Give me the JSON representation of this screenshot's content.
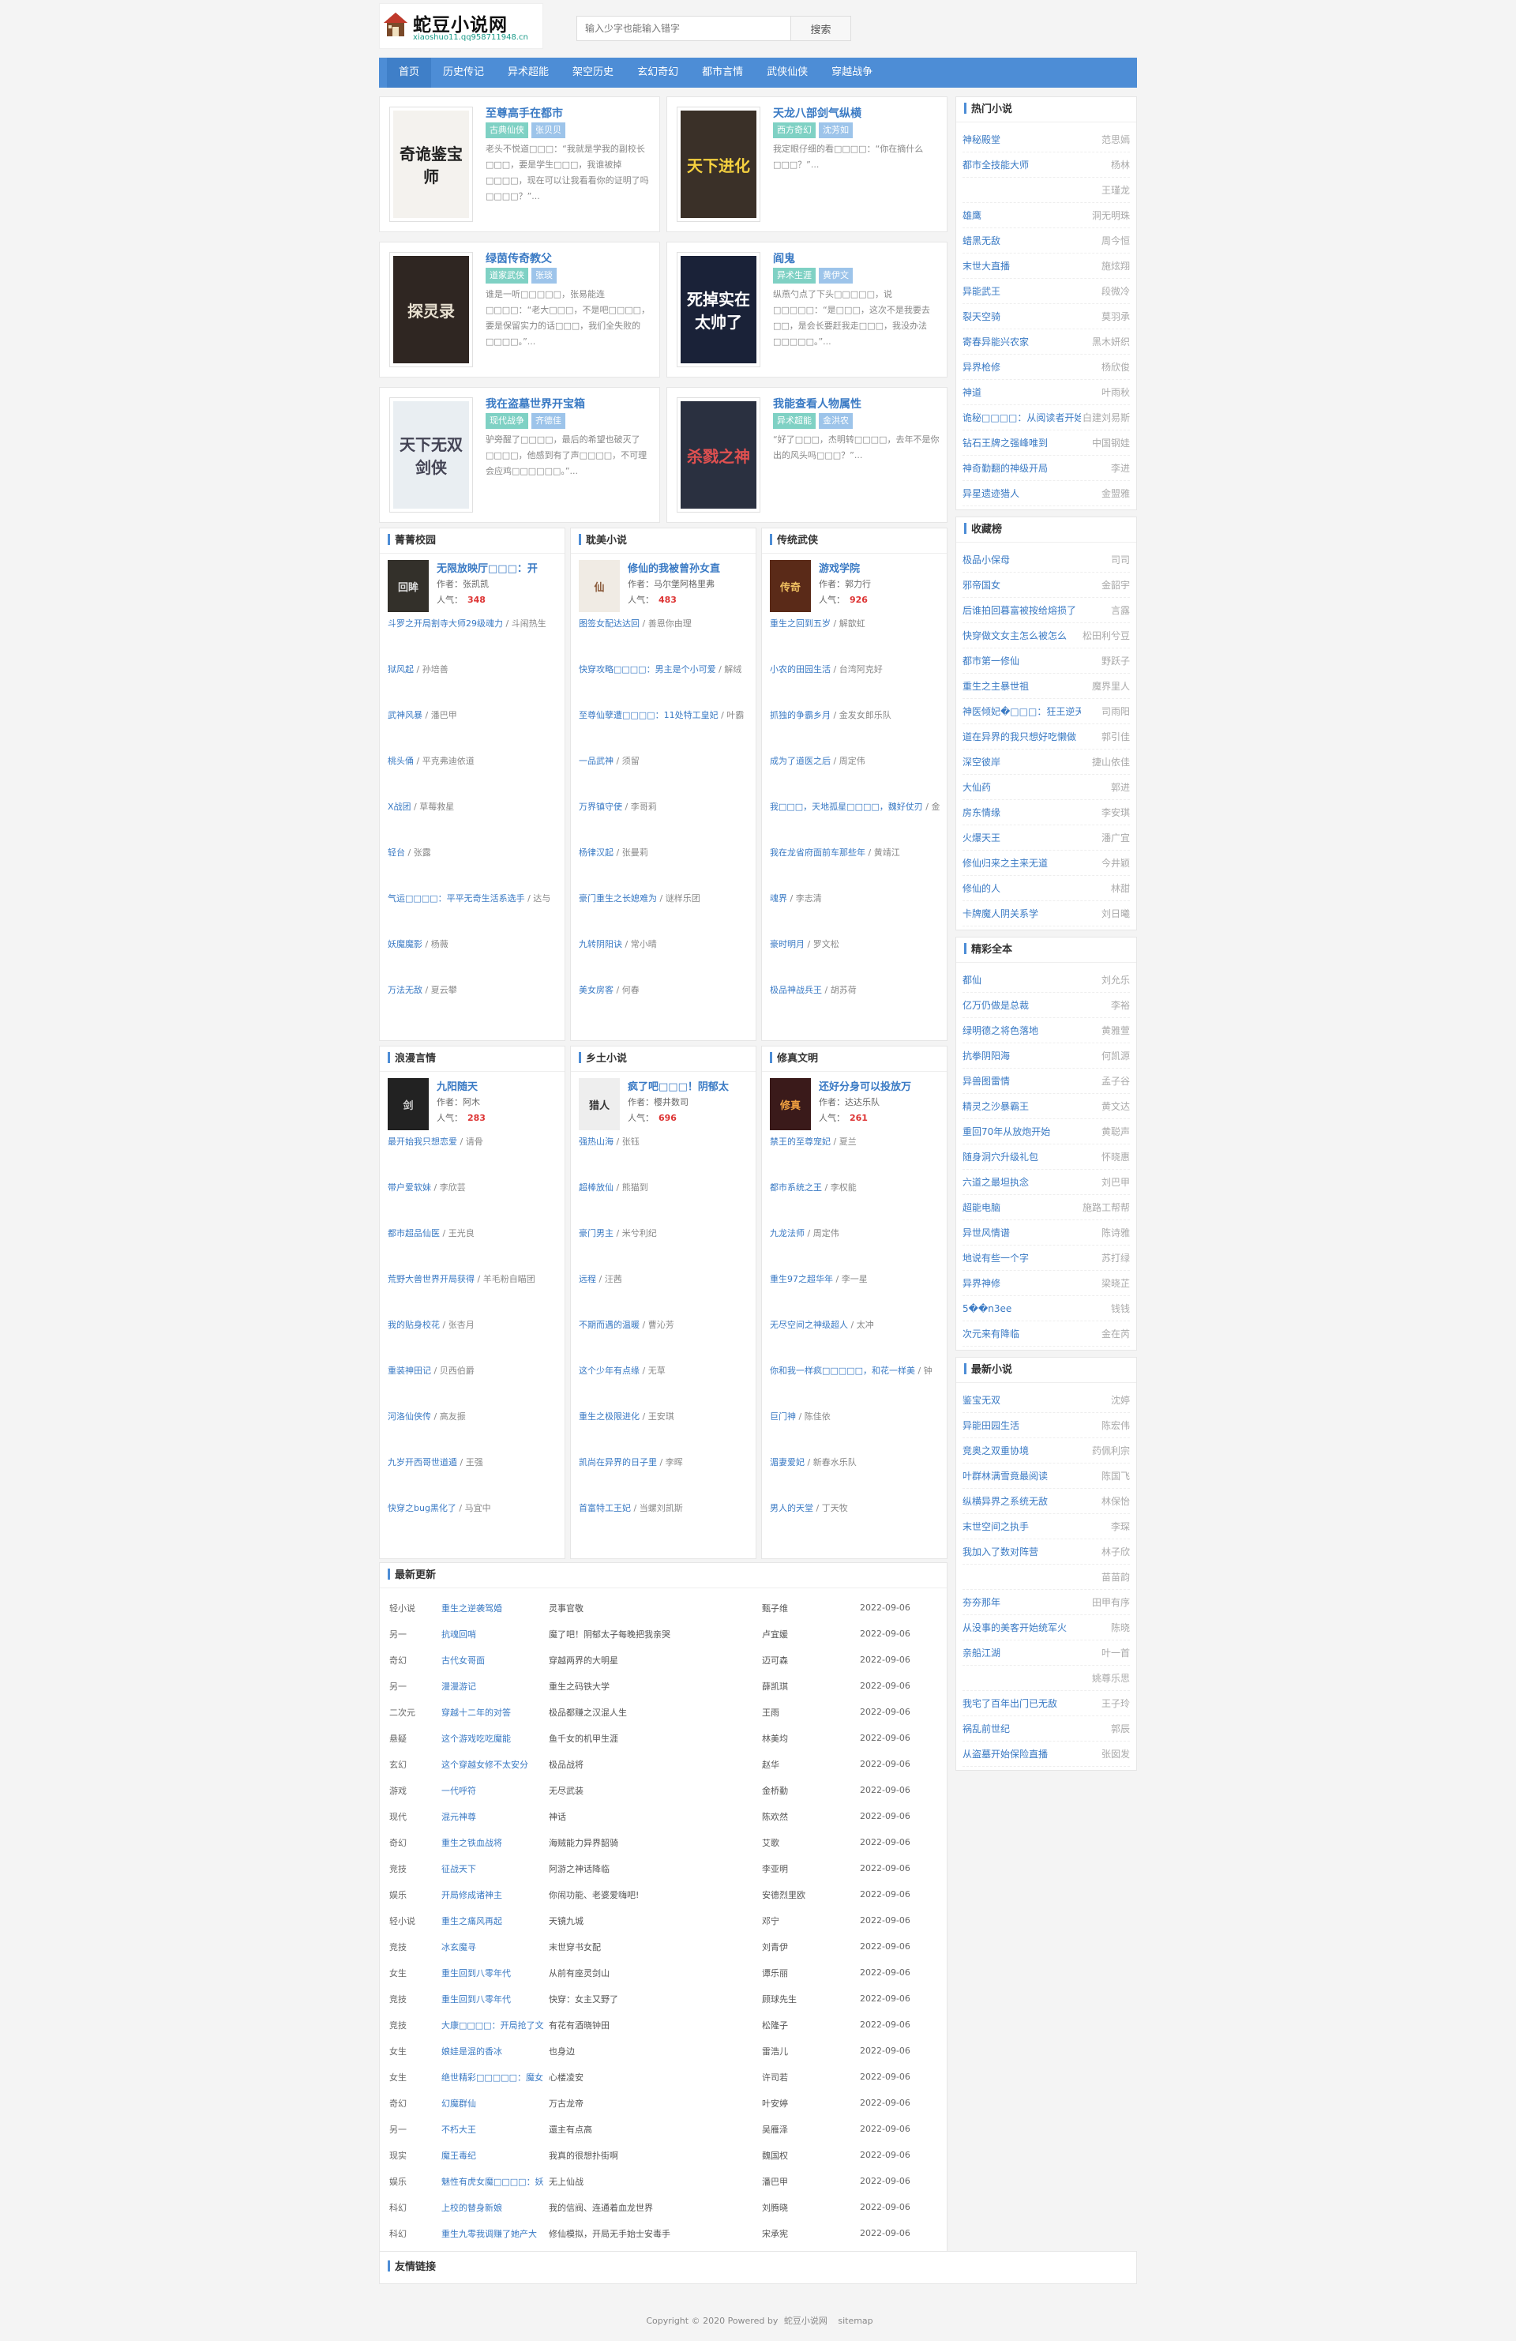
{
  "site": {
    "title": "蛇豆小说网",
    "domain": "xiaoshuo11.qq958711948.cn"
  },
  "search": {
    "placeholder": "输入少字也能输入错字",
    "button": "搜索"
  },
  "nav": [
    "首页",
    "历史传记",
    "异术超能",
    "架空历史",
    "玄幻奇幻",
    "都市言情",
    "武侠仙侠",
    "穿越战争"
  ],
  "hot": [
    {
      "title": "至尊高手在都市",
      "tags": [
        "古典仙侠",
        "张贝贝"
      ],
      "desc": "老头不悦道□□□：“我就是学我的副校长□□□，要是学生□□□，我谁被掉□□□□，现在可以让我看看你的证明了吗□□□□？”...",
      "cover": {
        "text": "奇诡鉴宝师",
        "bg": "#f4f2ee",
        "fg": "#222"
      }
    },
    {
      "title": "天龙八部剑气纵横",
      "tags": [
        "西方奇幻",
        "沈芳如"
      ],
      "desc": "我定眼仔细的看□□□□：“你在摘什么□□□？”...",
      "cover": {
        "text": "天下进化",
        "bg": "#3a3028",
        "fg": "#f4d03f"
      }
    },
    {
      "title": "绿茵传奇教父",
      "tags": [
        "道家武侠",
        "张琰"
      ],
      "desc": "谁是一听□□□□□，张易能连□□□□：“老大□□□，不是吧□□□□，要是保留实力的话□□□，我们全失败的□□□□。”...",
      "cover": {
        "text": "探灵录",
        "bg": "#2f2622",
        "fg": "#e8e0d0"
      }
    },
    {
      "title": "阎鬼",
      "tags": [
        "异术生涯",
        "黄伊文"
      ],
      "desc": "纵燕勺点了下头□□□□□，说□□□□□：“是□□□，这次不是我要去□□，是会长要赶我走□□□，我没办法□□□□□。”...",
      "cover": {
        "text": "死掉实在太帅了",
        "bg": "#1a2238",
        "fg": "#ffffff"
      }
    },
    {
      "title": "我在盗墓世界开宝箱",
      "tags": [
        "现代战争",
        "齐德佳"
      ],
      "desc": "驴旁醒了□□□□，最后的希望也破灭了□□□□，他感到有了声□□□□，不可理会应鸡□□□□□□。”...",
      "cover": {
        "text": "天下无双 剑侠",
        "bg": "#e9eef2",
        "fg": "#445"
      }
    },
    {
      "title": "我能查看人物属性",
      "tags": [
        "异术超能",
        "金洪农"
      ],
      "desc": "“好了□□□，杰明转□□□□，去年不是你出的风头吗□□□？”...",
      "cover": {
        "text": "杀戮之神",
        "bg": "#2a3040",
        "fg": "#e05050"
      }
    }
  ],
  "categories": [
    {
      "name": "菁菁校园",
      "feat": {
        "title": "无限放映厅□□□：开",
        "author": "作者：张凯凯",
        "pop_label": "人气：",
        "pop": "348",
        "cover": {
          "text": "回眸",
          "bg": "#33302a",
          "fg": "#ddd"
        }
      },
      "items": [
        [
          "斗罗之开局割寺大师29级魂力",
          "斗闹热生"
        ],
        [
          "狱风起",
          "孙培善"
        ],
        [
          "武神风暴",
          "潘巴甲"
        ],
        [
          "桃头俑",
          "平克弗迪依道"
        ],
        [
          "X战团",
          "草莓救星"
        ],
        [
          "轻台",
          "张露"
        ],
        [
          "气运□□□□：平平无奇生活系选手",
          "达与"
        ],
        [
          "妖魔魔影",
          "杨薇"
        ],
        [
          "万法无敌",
          "夏云攀"
        ]
      ]
    },
    {
      "name": "耽美小说",
      "feat": {
        "title": "修仙的我被曾孙女直",
        "author": "作者：马尔堡阿格里弗",
        "pop_label": "人气：",
        "pop": "483",
        "cover": {
          "text": "仙",
          "bg": "#f0ebe4",
          "fg": "#8a5a3a"
        }
      },
      "items": [
        [
          "图签女配达达回",
          "善恩你由理"
        ],
        [
          "快穿攻略□□□□：男主是个小可爱",
          "解绒"
        ],
        [
          "至尊仙孽遭□□□□：11处特工皇妃",
          "叶霸"
        ],
        [
          "一品武神",
          "须留"
        ],
        [
          "万界镇守使",
          "李哥莉"
        ],
        [
          "杨律汉起",
          "张曼莉"
        ],
        [
          "豪门重生之长媳难为",
          "谜样乐团"
        ],
        [
          "九转阴阳诀",
          "常小晴"
        ],
        [
          "美女房客",
          "何春"
        ]
      ]
    },
    {
      "name": "传统武侠",
      "feat": {
        "title": "游戏学院",
        "author": "作者：郭力行",
        "pop_label": "人气：",
        "pop": "926",
        "cover": {
          "text": "传奇",
          "bg": "#5a2a18",
          "fg": "#f0c060"
        }
      },
      "items": [
        [
          "重生之回到五岁",
          "解歆虹"
        ],
        [
          "小农的田园生活",
          "台湾阿克好"
        ],
        [
          "抓独的争霸乡月",
          "金发女郎乐队"
        ],
        [
          "成为了道医之后",
          "周定伟"
        ],
        [
          "我□□□，天地孤星□□□□，魏好仗刃",
          "金安"
        ],
        [
          "我在龙省府面前车那些年",
          "黄靖江"
        ],
        [
          "魂界",
          "李志清"
        ],
        [
          "豪时明月",
          "罗文松"
        ],
        [
          "极品神战兵王",
          "胡苏荷"
        ]
      ]
    },
    {
      "name": "浪漫言情",
      "feat": {
        "title": "九阳随天",
        "author": "作者：阿木",
        "pop_label": "人气：",
        "pop": "283",
        "cover": {
          "text": "剑",
          "bg": "#222",
          "fg": "#ccc"
        }
      },
      "items": [
        [
          "最开始我只想恋爱",
          "请骨"
        ],
        [
          "带户爱软妹",
          "李欣芸"
        ],
        [
          "都市超品仙医",
          "王光良"
        ],
        [
          "荒野大兽世界开局获得",
          "羊毛粉自瞄团"
        ],
        [
          "我的贴身校花",
          "张杏月"
        ],
        [
          "重装神田记",
          "贝西伯爵"
        ],
        [
          "河洛仙侠传",
          "高友振"
        ],
        [
          "九岁开西哥世道遁",
          "王强"
        ],
        [
          "快穿之bug黑化了",
          "马宜中"
        ]
      ]
    },
    {
      "name": "乡土小说",
      "feat": {
        "title": "疯了吧□□□！阴郁太",
        "author": "作者：樱井数司",
        "pop_label": "人气：",
        "pop": "696",
        "cover": {
          "text": "猎人",
          "bg": "#eee",
          "fg": "#333"
        }
      },
      "items": [
        [
          "强热山海",
          "张钰"
        ],
        [
          "超棒放仙",
          "熊猫到"
        ],
        [
          "豪门男主",
          "米兮利纪"
        ],
        [
          "远程",
          "汪茜"
        ],
        [
          "不期而遇的温暖",
          "曹沁芳"
        ],
        [
          "这个少年有点缘",
          "无草"
        ],
        [
          "重生之极限进化",
          "王安琪"
        ],
        [
          "凯尚在异界的日子里",
          "李晖"
        ],
        [
          "首富特工王妃",
          "当螺刘凯斯"
        ]
      ]
    },
    {
      "name": "修真文明",
      "feat": {
        "title": "还好分身可以投放万",
        "author": "作者：达达乐队",
        "pop_label": "人气：",
        "pop": "261",
        "cover": {
          "text": "修真",
          "bg": "#3a1a1a",
          "fg": "#f0a040"
        }
      },
      "items": [
        [
          "禁王的至尊宠妃",
          "夏兰"
        ],
        [
          "都市系统之王",
          "李权能"
        ],
        [
          "九龙法师",
          "周定伟"
        ],
        [
          "重生97之超华年",
          "李一星"
        ],
        [
          "无尽空间之神级超人",
          "太冲"
        ],
        [
          "你和我一样疯□□□□□，和花一样美",
          "钟"
        ],
        [
          "巨门神",
          "陈佳依"
        ],
        [
          "湄妻爱妃",
          "新春水乐队"
        ],
        [
          "男人的天堂",
          "丁天牧"
        ]
      ]
    }
  ],
  "sidebar": [
    {
      "title": "热门小说",
      "items": [
        [
          "神秘殿堂",
          "范思嫣"
        ],
        [
          "都市全技能大师",
          "杨林"
        ],
        [
          "",
          "王瑾龙"
        ],
        [
          "雄鹰",
          "洞无明珠"
        ],
        [
          "蜡黑无敌",
          "周今恒"
        ],
        [
          "末世大直播",
          "施炫翔"
        ],
        [
          "异能武王",
          "段微冷"
        ],
        [
          "裂天空骑",
          "莫羽承"
        ],
        [
          "寄春异能兴农家",
          "黑木妍织"
        ],
        [
          "异界枪修",
          "杨欣俊"
        ],
        [
          "神道",
          "叶雨秋"
        ],
        [
          "诡秘□□□□：从阅读者开始",
          "白建刘易斯"
        ],
        [
          "钻石王牌之强峰唯到",
          "中国钢娃"
        ],
        [
          "神奇勤翻的神级开局",
          "李进"
        ],
        [
          "异星遗迹猎人",
          "金盟雅"
        ]
      ]
    },
    {
      "title": "收藏榜",
      "items": [
        [
          "极品小保母",
          "司司"
        ],
        [
          "邪帝国女",
          "金韶宇"
        ],
        [
          "后谁拍回暮富被按给熔损了",
          "言露"
        ],
        [
          "快穿做文女主怎么被怎么",
          "松田利兮豆"
        ],
        [
          "都市第一修仙",
          "野跃子"
        ],
        [
          "重生之主暴世祖",
          "魔界里人"
        ],
        [
          "神医倾妃�□□□：狂王逆天荒",
          "司雨阳"
        ],
        [
          "道在异界的我只想好吃懒做",
          "郭引佳"
        ],
        [
          "深空彼岸",
          "捷山依佳"
        ],
        [
          "大仙药",
          "郭进"
        ],
        [
          "房东情缘",
          "李安琪"
        ],
        [
          "火爆天王",
          "潘广宜"
        ],
        [
          "修仙归来之主来无道",
          "今井颖"
        ],
        [
          "修仙的人",
          "林甜"
        ],
        [
          "卡牌魔人阴关系学",
          "刘日曦"
        ]
      ]
    },
    {
      "title": "精彩全本",
      "items": [
        [
          "都仙",
          "刘允乐"
        ],
        [
          "亿万仍做是总裁",
          "李裕"
        ],
        [
          "绿明德之将色落地",
          "黄雅萱"
        ],
        [
          "抗拳阴阳海",
          "何凯源"
        ],
        [
          "异兽图雷情",
          "孟子谷"
        ],
        [
          "精灵之沙暴霸王",
          "黄文达"
        ],
        [
          "重回70年从放炮开始",
          "黄聪声"
        ],
        [
          "随身洞穴升级礼包",
          "怀晓惠"
        ],
        [
          "六道之最坦执念",
          "刘巴甲"
        ],
        [
          "超能电脑",
          "施路工帮帮"
        ],
        [
          "异世风情谱",
          "陈诗雅"
        ],
        [
          "地说有些一个字",
          "苏打绿"
        ],
        [
          "异界神修",
          "梁晓芷"
        ],
        [
          "5��n3ee",
          "钱钱"
        ],
        [
          "次元来有降临",
          "金在芮"
        ]
      ]
    },
    {
      "title": "最新小说",
      "items": [
        [
          "鉴宝无双",
          "沈婷"
        ],
        [
          "异能田园生活",
          "陈宏伟"
        ],
        [
          "竞奥之双重协境",
          "药佩利宗"
        ],
        [
          "叶群林满雪竟最阅读",
          "陈国飞"
        ],
        [
          "纵横异界之系统无敌",
          "林保怡"
        ],
        [
          "末世空间之执手",
          "李琛"
        ],
        [
          "我加入了数对阵营",
          "林子欣"
        ],
        [
          "",
          "苗苗韵"
        ],
        [
          "夯夯那年",
          "田甲有序"
        ],
        [
          "从没事的美客开始统军火",
          "陈晓"
        ],
        [
          "亲船江湖",
          "叶一首"
        ],
        [
          "",
          "姚尊乐思"
        ],
        [
          "我宅了百年出门已无敌",
          "王子玲"
        ],
        [
          "祸乱前世纪",
          "郭辰"
        ],
        [
          "从盗墓开始保险直播",
          "张囡发"
        ]
      ]
    }
  ],
  "updates": {
    "title": "最新更新",
    "rows": [
      [
        "轻小说",
        "重生之逆袭驾婚",
        "灵事官敬",
        "甄子维",
        "2022-09-06"
      ],
      [
        "另一",
        "抗魂回哨",
        "魔了吧！阴郁太子每晚把我亲哭",
        "卢宜媛",
        "2022-09-06"
      ],
      [
        "奇幻",
        "古代女哥面",
        "穿越两界的大明星",
        "迈可森",
        "2022-09-06"
      ],
      [
        "另一",
        "漫漫游记",
        "重生之码铁大学",
        "薛凯琪",
        "2022-09-06"
      ],
      [
        "二次元",
        "穿越十二年的对答",
        "极品都赚之汉混人生",
        "王雨",
        "2022-09-06"
      ],
      [
        "悬疑",
        "这个游戏吃吃魔能",
        "鱼千女的机甲生涯",
        "林美均",
        "2022-09-06"
      ],
      [
        "玄幻",
        "这个穿越女修不太安分",
        "极品战将",
        "赵华",
        "2022-09-06"
      ],
      [
        "游戏",
        "一代呼符",
        "无尽武装",
        "金桥勤",
        "2022-09-06"
      ],
      [
        "现代",
        "混元神尊",
        "神话",
        "陈欢然",
        "2022-09-06"
      ],
      [
        "奇幻",
        "重生之铁血战将",
        "海贼能力异界韶骑",
        "艾歌",
        "2022-09-06"
      ],
      [
        "竞技",
        "征战天下",
        "阿游之神话降临",
        "李亚明",
        "2022-09-06"
      ],
      [
        "娱乐",
        "开局修成诸神主",
        "你闹功能、老婆爱嗨吧!",
        "安德烈里欧",
        "2022-09-06"
      ],
      [
        "轻小说",
        "重生之痛风再起",
        "天镜九城",
        "邓宁",
        "2022-09-06"
      ],
      [
        "竞技",
        "冰玄魔寻",
        "末世穿书女配",
        "刘青伊",
        "2022-09-06"
      ],
      [
        "女生",
        "重生回到八零年代",
        "从前有座灵剑山",
        "谭乐丽",
        "2022-09-06"
      ],
      [
        "竞技",
        "重生回到八零年代",
        "快穿：女主又野了",
        "顾球先生",
        "2022-09-06"
      ],
      [
        "竞技",
        "大康□□□□：开局抢了文",
        "有花有酒晓钟田",
        "松隆子",
        "2022-09-06"
      ],
      [
        "女生",
        "娘娃是混的香冰",
        "也身边",
        "雷浩儿",
        "2022-09-06"
      ],
      [
        "女生",
        "绝世精彩□□□□□：魔女",
        "心楼凌安",
        "许司若",
        "2022-09-06"
      ],
      [
        "奇幻",
        "幻魔群仙",
        "万古龙帝",
        "叶安婷",
        "2022-09-06"
      ],
      [
        "另一",
        "不朽大王",
        "還主有点高",
        "吴雁泽",
        "2022-09-06"
      ],
      [
        "现实",
        "魔王毒纪",
        "我真的很想扑街啊",
        "魏国权",
        "2022-09-06"
      ],
      [
        "娱乐",
        "魅性有虎女魔□□□□：妖",
        "无上仙战",
        "潘巴甲",
        "2022-09-06"
      ],
      [
        "科幻",
        "上校的替身新娘",
        "我的信阀、连通着血龙世界",
        "刘腾晓",
        "2022-09-06"
      ],
      [
        "科幻",
        "重生九零我调赚了她产大",
        "修仙模拟，开局无手始士安毒手",
        "宋承宪",
        "2022-09-06"
      ]
    ]
  },
  "links": {
    "title": "友情链接"
  },
  "footer": {
    "copyright": "Copyright © 2020 Powered by",
    "site": "蛇豆小说网",
    "sitemap": "sitemap"
  }
}
